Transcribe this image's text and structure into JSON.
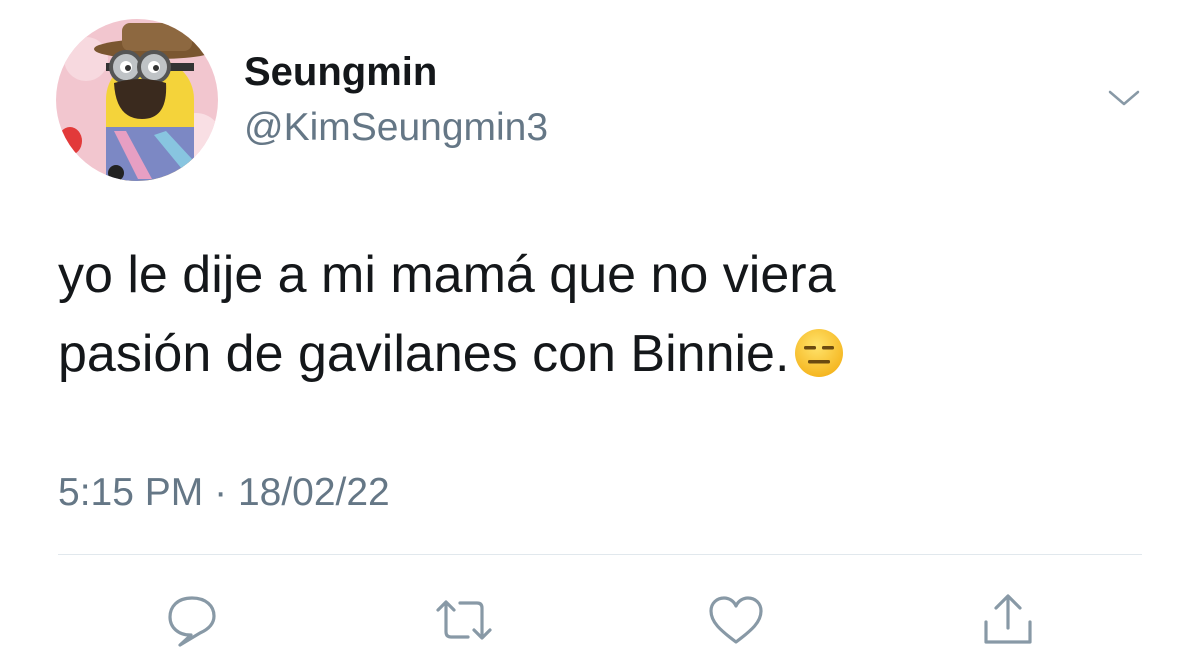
{
  "tweet": {
    "display_name": "Seungmin",
    "handle": "@KimSeungmin3",
    "text_lines": [
      "yo le dije a mi mamá que no viera",
      "pasión de gavilanes con Binnie."
    ],
    "emoji": "expressionless-face",
    "time": "5:15 PM",
    "separator": "·",
    "date": "18/02/22"
  },
  "actions": [
    "reply-icon",
    "retweet-icon",
    "like-icon",
    "share-icon"
  ],
  "colors": {
    "text": "#14171a",
    "secondary": "#657786",
    "divider": "#e1e8ed"
  }
}
